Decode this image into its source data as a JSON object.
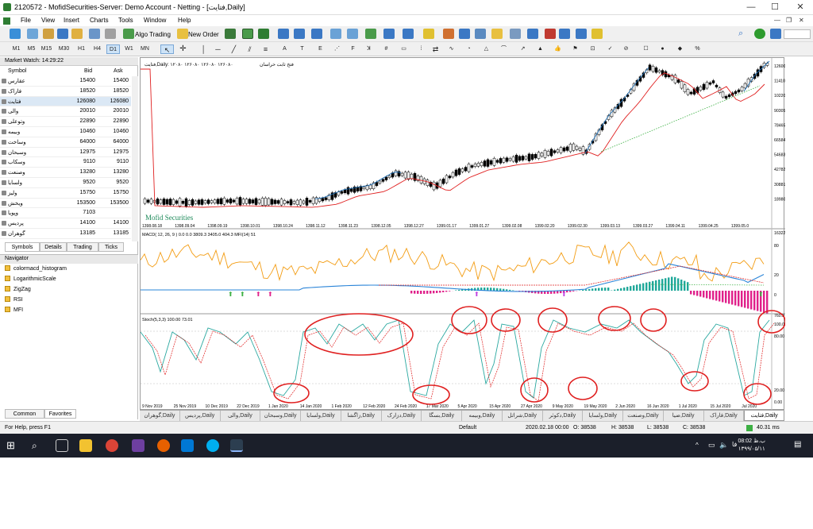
{
  "titlebar": {
    "title": "2120572 - MofidSecurities-Server: Demo Account - Netting - [فتایت,Daily]"
  },
  "menu": [
    "File",
    "View",
    "Insert",
    "Charts",
    "Tools",
    "Window",
    "Help"
  ],
  "toolbar": {
    "algo": "Algo Trading",
    "neworder": "New Order"
  },
  "timeframes": [
    "M1",
    "M5",
    "M15",
    "M30",
    "H1",
    "H4",
    "D1",
    "W1",
    "MN"
  ],
  "market_watch": {
    "header": "Market Watch: 14:29:22",
    "cols": {
      "symbol": "Symbol",
      "bid": "Bid",
      "ask": "Ask"
    },
    "rows": [
      {
        "s": "عقارس",
        "b": "15400",
        "a": "15400"
      },
      {
        "s": "فاراک",
        "b": "18520",
        "a": "18520"
      },
      {
        "s": "فتایت",
        "b": "126080",
        "a": "126080"
      },
      {
        "s": "والی",
        "b": "20010",
        "a": "20010"
      },
      {
        "s": "وتوعلی",
        "b": "22890",
        "a": "22890"
      },
      {
        "s": "وبیمه",
        "b": "10460",
        "a": "10460"
      },
      {
        "s": "وساخت",
        "b": "64000",
        "a": "64000"
      },
      {
        "s": "وسبحان",
        "b": "12975",
        "a": "12975"
      },
      {
        "s": "وسکاب",
        "b": "9110",
        "a": "9110"
      },
      {
        "s": "وصنعت",
        "b": "13280",
        "a": "13280"
      },
      {
        "s": "ولسایا",
        "b": "9520",
        "a": "9520"
      },
      {
        "s": "ولیز",
        "b": "15750",
        "a": "15750"
      },
      {
        "s": "ویخش",
        "b": "153500",
        "a": "153500"
      },
      {
        "s": "وپویا",
        "b": "7103",
        "a": ""
      },
      {
        "s": "پردیس",
        "b": "14100",
        "a": "14100"
      },
      {
        "s": "گوهران",
        "b": "13185",
        "a": "13185"
      }
    ],
    "tabs": [
      "Symbols",
      "Details",
      "Trading",
      "Ticks"
    ]
  },
  "navigator": {
    "header": "Navigator",
    "items": [
      "colormacd_histogram",
      "LogarithmicScale",
      "ZigZag",
      "RSI",
      "MFI"
    ],
    "tabs": [
      "Common",
      "Favorites"
    ]
  },
  "chart": {
    "symbol_label": "فتایت,Daily: ۱۲۰۸۰ ۱۲۶۰۸۰ ۱۲۶۰۸۰ ۱۲۶۰۸۰",
    "symbol_label2": "فتخ ثابت خراسان",
    "watermark": "Mofid Securities",
    "price_ticks": [
      "126009",
      "114109",
      "102207",
      "90305",
      "78465",
      "66584",
      "54683",
      "42782",
      "30881",
      "18980"
    ],
    "top_dates": [
      "1398.08.18",
      "1398.09.04",
      "1398.09.19",
      "1398.10.01",
      "1398.10.24",
      "1398.11.12",
      "1398.11.23",
      "1398.12.05",
      "1398.12.27",
      "1399.01.17",
      "1399.01.27",
      "1399.02.08",
      "1399.02.20",
      "1399.02.30",
      "1399.03.13",
      "1399.03.27",
      "1399.04.11",
      "1399.04.25",
      "1399.05.0"
    ],
    "macd_label": "MACD( 12, 26, 9 ) 0.0 0.0 3809.3 3405.0 404.3  MFI(14) 51",
    "macd_ticks": [
      "16322.6",
      "80",
      "20",
      "0"
    ],
    "stoch_label": "Stoch(5,3,3) 100.00 73.01",
    "stoch_ticks": [
      "760.3",
      "100.00",
      "80.00",
      "20.00",
      "0.00"
    ],
    "bottom_dates": [
      "9 Nov 2019",
      "25 Nov 2019",
      "10 Dec 2019",
      "22 Dec 2019",
      "1 Jan 2020",
      "14 Jan 2020",
      "1 Feb 2020",
      "12 Feb 2020",
      "24 Feb 2020",
      "17 Mar 2020",
      "5 Apr 2020",
      "15 Apr 2020",
      "27 Apr 2020",
      "9 May 2020",
      "19 May 2020",
      "2 Jun 2020",
      "16 Jun 2020",
      "1 Jul 2020",
      "15 Jul 2020",
      "Jul 2020"
    ]
  },
  "chart_tabs": [
    "گوهران,Daily",
    "پردیس,Daily",
    "والی,Daily",
    "وسبحان,Daily",
    "ولسایا,Daily",
    "زاگشا,Daily",
    "دزارک,Daily",
    "بسگا,Daily",
    "وبیمه,Daily",
    "شراتل,Daily",
    "دکوثر,Daily",
    "ولسایا,Daily",
    "وصنعت,Daily",
    "ضیا,Daily",
    "فاراک,Daily",
    "فتایت,Daily"
  ],
  "status": {
    "help": "For Help, press F1",
    "profile": "Default",
    "datetime": "2020.02.18 00:00",
    "open": "O: 38538",
    "high": "H: 38538",
    "low": "L: 38538",
    "close": "C: 38538",
    "speed": "40.31 ms"
  },
  "clock": {
    "time": "08:02 ب.ظ",
    "date": "۱۳۹۹/۰۵/۱۱"
  },
  "colors": {
    "bull": "#1f6fb5",
    "ma_red": "#e02020",
    "macd_blue": "#2a84d8",
    "mfi_orange": "#f39c12",
    "stoch_teal": "#2aa8a0",
    "annot": "#e02020"
  }
}
